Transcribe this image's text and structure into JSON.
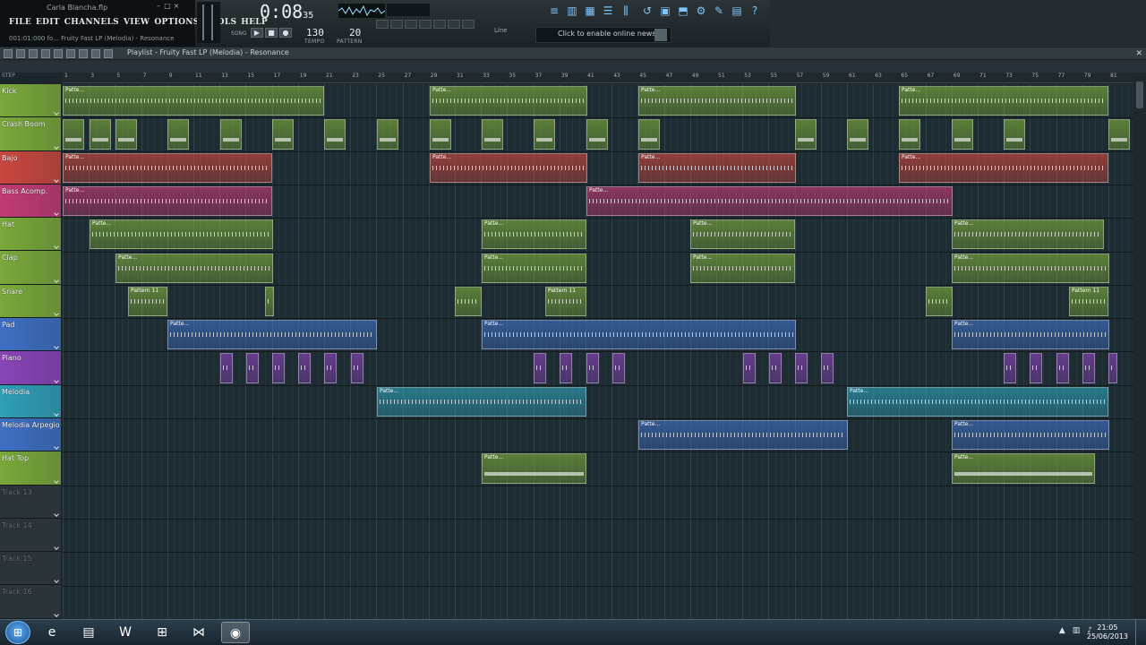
{
  "app": {
    "song_title": "Carla Blancha.flp",
    "hint": "001:01:000 fo... Fruity Fast LP (Melodia) - Resonance",
    "menu": [
      "FILE",
      "EDIT",
      "CHANNELS",
      "VIEW",
      "OPTIONS",
      "TOOLS",
      "HELP"
    ]
  },
  "transport": {
    "time": "0:08",
    "time_fraction": "35",
    "song_label": "SONG",
    "tempo": "130",
    "tempo_label": "TEMPO",
    "pattern": "20",
    "pattern_label": "PATTERN",
    "snap": "Line",
    "news": "Click to enable online news"
  },
  "playlist": {
    "title": "Playlist - Fruity Fast LP (Melodia) - Resonance",
    "snap_label": "STEP",
    "ruler": [
      "1",
      "3",
      "5",
      "7",
      "9",
      "11",
      "13",
      "15",
      "17",
      "19",
      "21",
      "23",
      "25",
      "27",
      "29",
      "31",
      "33",
      "35",
      "37",
      "39",
      "41",
      "43",
      "45",
      "47",
      "49",
      "51",
      "53",
      "55",
      "57",
      "59",
      "61",
      "63",
      "65",
      "67",
      "69",
      "71",
      "73",
      "75",
      "77",
      "79",
      "81"
    ],
    "tracks": [
      {
        "name": "Kick",
        "color": "#7aa83a"
      },
      {
        "name": "Crash Boom",
        "color": "#7aa83a"
      },
      {
        "name": "Bajo",
        "color": "#c9473e"
      },
      {
        "name": "Bass Acomp.",
        "color": "#c23a73"
      },
      {
        "name": "Hat",
        "color": "#7aa83a"
      },
      {
        "name": "Clap",
        "color": "#7aa83a"
      },
      {
        "name": "Snare",
        "color": "#7aa83a"
      },
      {
        "name": "Pad",
        "color": "#3e6fc2"
      },
      {
        "name": "Piano",
        "color": "#8a44b8"
      },
      {
        "name": "Melodia",
        "color": "#2f9fb8"
      },
      {
        "name": "Melodia Arpegio",
        "color": "#3e6fc2"
      },
      {
        "name": "Hat Top",
        "color": "#7aa83a"
      },
      {
        "name": "Track 13",
        "color": "#3a4549"
      },
      {
        "name": "Track 14",
        "color": "#3a4549"
      },
      {
        "name": "Track 15",
        "color": "#3a4549"
      },
      {
        "name": "Track 16",
        "color": "#3a4549"
      }
    ],
    "clip_labels": {
      "pattern": "Patte...",
      "snare": "Pattern 11"
    }
  },
  "taskbar": {
    "time": "21:05",
    "date": "25/06/2013",
    "apps": [
      {
        "icon": "ie-icon",
        "glyph": "e"
      },
      {
        "icon": "explorer-icon",
        "glyph": "▤"
      },
      {
        "icon": "word-icon",
        "glyph": "W"
      },
      {
        "icon": "network-icon",
        "glyph": "⊞"
      },
      {
        "icon": "visualstudio-icon",
        "glyph": "⋈"
      },
      {
        "icon": "flstudio-icon",
        "glyph": "◉"
      }
    ]
  }
}
